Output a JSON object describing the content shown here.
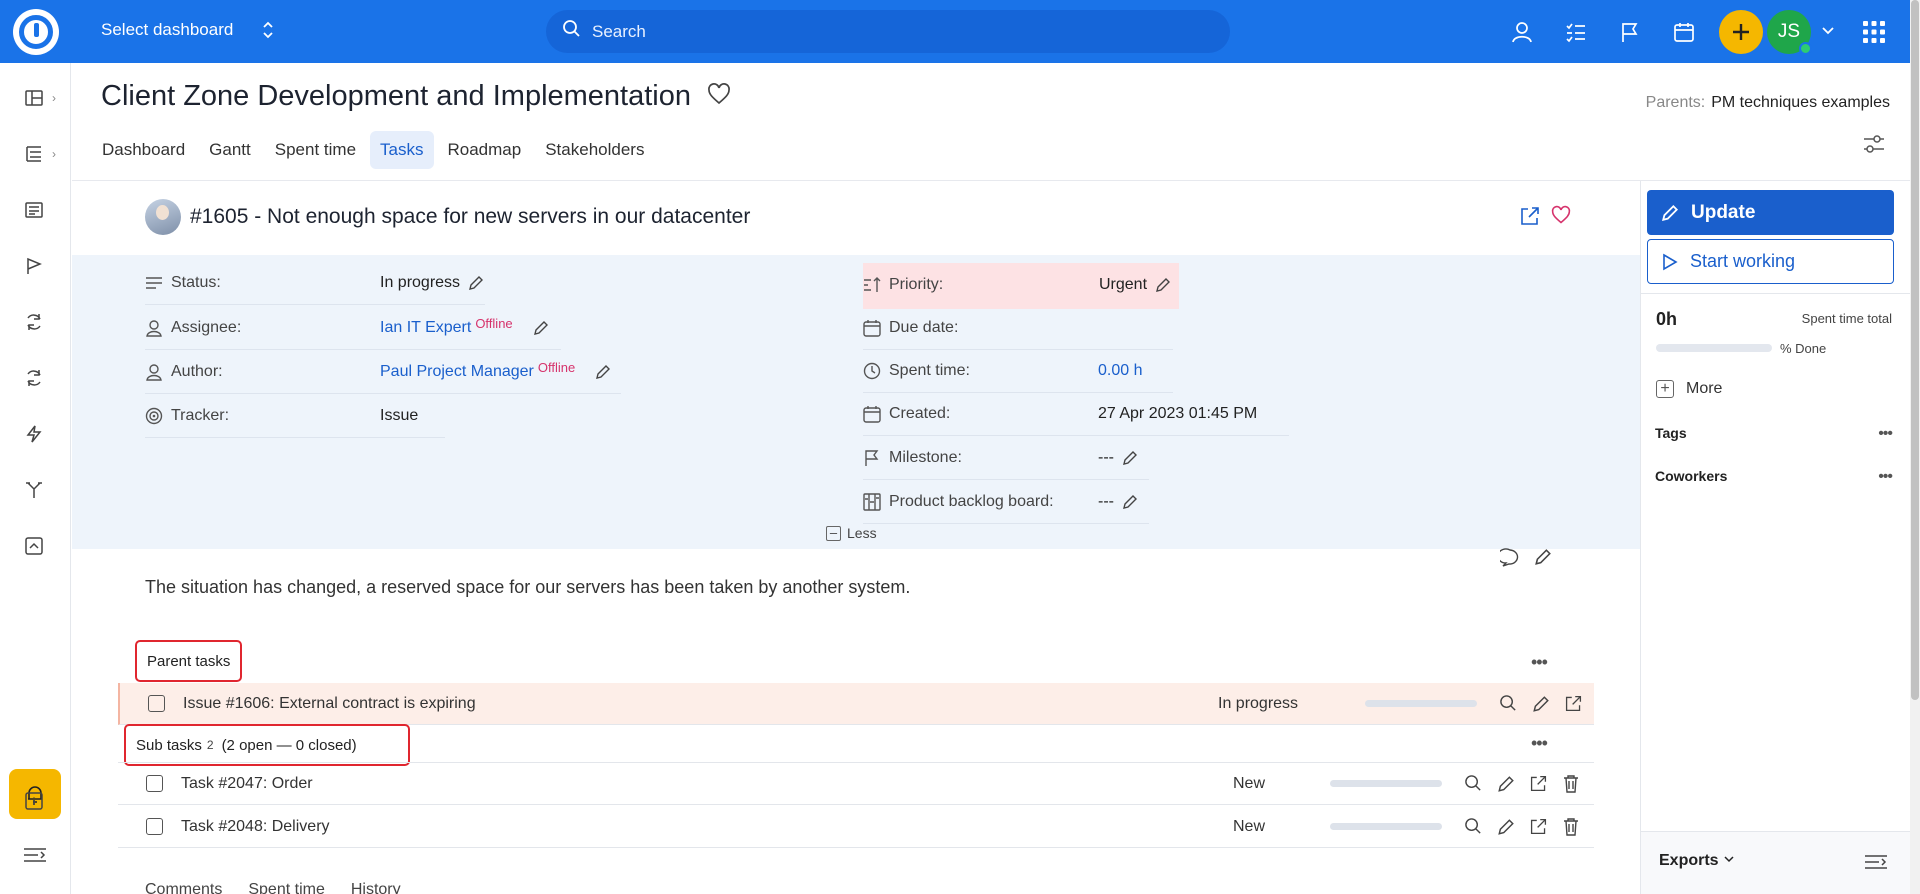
{
  "topbar": {
    "dashboard_select": "Select dashboard",
    "search_placeholder": "Search",
    "avatar_initials": "JS"
  },
  "project": {
    "title": "Client Zone Development and Implementation",
    "parents_label": "Parents:",
    "parents_value": "PM techniques examples"
  },
  "tabs": [
    "Dashboard",
    "Gantt",
    "Spent time",
    "Tasks",
    "Roadmap",
    "Stakeholders"
  ],
  "active_tab": "Tasks",
  "issue": {
    "title": "#1605 - Not enough space for new servers in our datacenter",
    "left_attributes": {
      "status_label": "Status:",
      "status_value": "In progress",
      "assignee_label": "Assignee:",
      "assignee_value": "Ian IT Expert",
      "assignee_presence": "Offline",
      "author_label": "Author:",
      "author_value": "Paul Project Manager",
      "author_presence": "Offline",
      "tracker_label": "Tracker:",
      "tracker_value": "Issue"
    },
    "right_attributes": {
      "priority_label": "Priority:",
      "priority_value": "Urgent",
      "due_label": "Due date:",
      "due_value": "",
      "spent_label": "Spent time:",
      "spent_value": "0.00 h",
      "created_label": "Created:",
      "created_value": "27 Apr 2023 01:45 PM",
      "milestone_label": "Milestone:",
      "milestone_value": "---",
      "backlog_label": "Product backlog board:",
      "backlog_value": "---"
    },
    "less_label": "Less",
    "description": "The situation has changed, a reserved space for our servers has been taken by another system."
  },
  "parent_tasks": {
    "label": "Parent tasks",
    "rows": [
      {
        "name": "Issue #1606: External contract is expiring",
        "status": "In progress",
        "progress": 0
      }
    ]
  },
  "sub_tasks": {
    "label": "Sub tasks",
    "count": "2",
    "summary": "(2 open — 0 closed)",
    "rows": [
      {
        "name": "Task #2047: Order",
        "status": "New",
        "progress": 0
      },
      {
        "name": "Task #2048: Delivery",
        "status": "New",
        "progress": 0
      }
    ]
  },
  "bottom_tabs": [
    "Comments",
    "Spent time",
    "History"
  ],
  "sidebar": {
    "update_label": "Update",
    "start_label": "Start working",
    "hours": "0h",
    "spent_total_label": "Spent time total",
    "done_label": "% Done",
    "done_value": 0,
    "more_label": "More",
    "tags_label": "Tags",
    "coworkers_label": "Coworkers",
    "exports_label": "Exports"
  },
  "colors": {
    "brand_blue": "#1a73e8",
    "accent_yellow": "#f5b700",
    "offline_pink": "#d6336c",
    "highlight_red": "#e0262f"
  }
}
